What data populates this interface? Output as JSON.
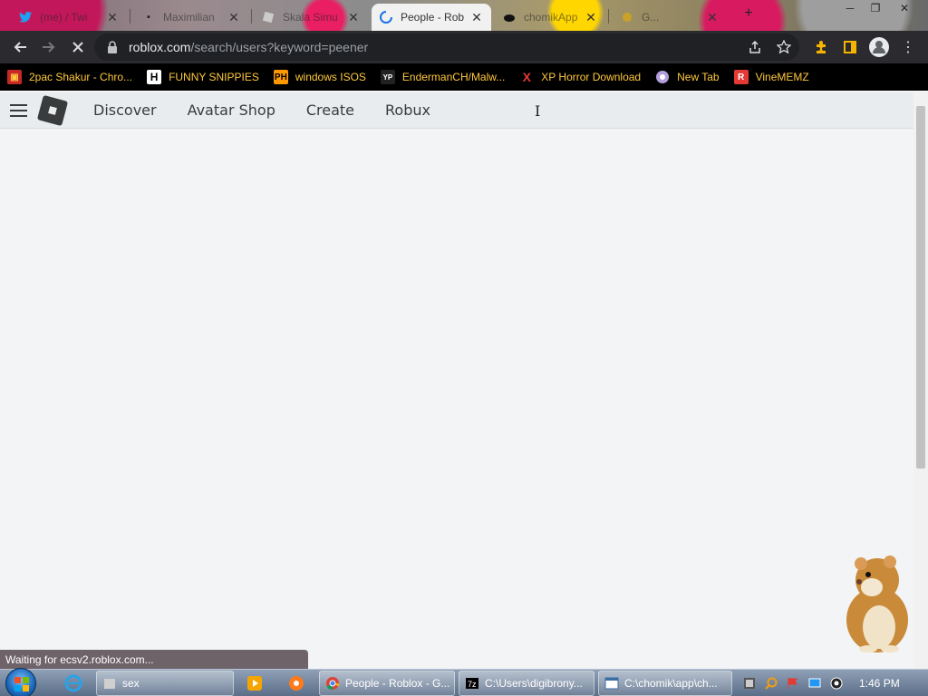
{
  "browser": {
    "tabs": [
      {
        "title": "(me) / Twi",
        "favicon": "twitter-icon",
        "active": false
      },
      {
        "title": "Maximilian",
        "favicon": "tab-favicon",
        "active": false
      },
      {
        "title": "Skala Simu",
        "favicon": "tab-favicon",
        "active": false
      },
      {
        "title": "People - Rob",
        "favicon": "loading-spinner-icon",
        "active": true
      },
      {
        "title": "chomikApp",
        "favicon": "cloud-icon",
        "active": false
      },
      {
        "title": "G...",
        "favicon": "tab-favicon",
        "active": false
      }
    ],
    "url_host": "roblox.com",
    "url_path": "/search/users?keyword=peener",
    "bookmarks": [
      {
        "label": "2pac Shakur - Chro...",
        "icon": "bookmark-icon"
      },
      {
        "label": "FUNNY SNIPPIES",
        "icon": "H"
      },
      {
        "label": "windows ISOS",
        "icon": "PH"
      },
      {
        "label": "EndermanCH/Malw...",
        "icon": "YP"
      },
      {
        "label": "XP Horror Download",
        "icon": "X"
      },
      {
        "label": "New Tab",
        "icon": "globe-icon"
      },
      {
        "label": "VineMEMZ",
        "icon": "R"
      }
    ],
    "status_text": "Waiting for ecsv2.roblox.com..."
  },
  "roblox_nav": {
    "links": [
      "Discover",
      "Avatar Shop",
      "Create",
      "Robux"
    ]
  },
  "taskbar": {
    "tasks": [
      {
        "label": "sex"
      },
      {
        "label": "People - Roblox - G..."
      },
      {
        "label": "C:\\Users\\digibrony..."
      },
      {
        "label": "C:\\chomik\\app\\ch..."
      }
    ],
    "clock": "1:46 PM"
  },
  "colors": {
    "bookmark_text": "#ffc83d",
    "toolbar_bg": "#2b2a2e",
    "roblox_nav_bg": "#e9ecee"
  }
}
